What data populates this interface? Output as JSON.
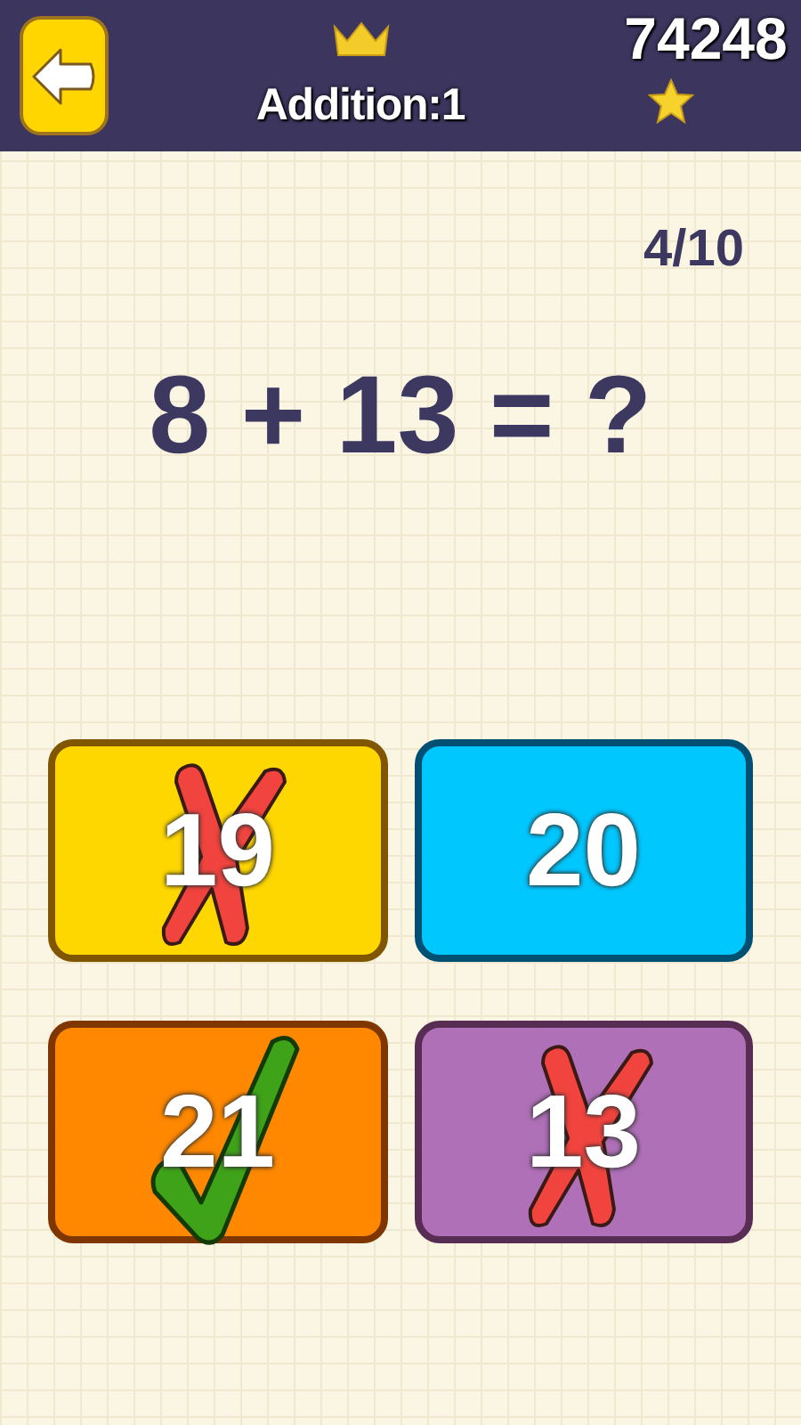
{
  "header": {
    "title": "Addition:1",
    "score": "74248"
  },
  "progress": "4/10",
  "question": "8 + 13 = ?",
  "answers": [
    {
      "label": "19",
      "color": "#ffd700",
      "kind": "wrong"
    },
    {
      "label": "20",
      "color": "#00c8ff",
      "kind": "plain"
    },
    {
      "label": "21",
      "color": "#ff8800",
      "kind": "correct"
    },
    {
      "label": "13",
      "color": "#b070b8",
      "kind": "wrong"
    }
  ]
}
